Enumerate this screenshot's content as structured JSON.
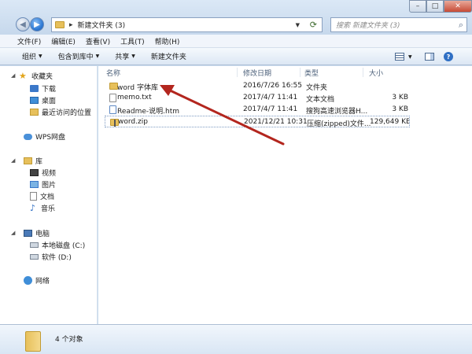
{
  "window": {
    "path": "新建文件夹 (3)",
    "search_placeholder": "搜索 新建文件夹 (3)"
  },
  "menu": [
    "文件(F)",
    "编辑(E)",
    "查看(V)",
    "工具(T)",
    "帮助(H)"
  ],
  "toolbar": [
    "组织",
    "包含到库中",
    "共享",
    "新建文件夹"
  ],
  "nav": {
    "favorites": "收藏夹",
    "downloads": "下载",
    "desktop": "桌面",
    "recent": "最近访问的位置",
    "wps": "WPS网盘",
    "libraries": "库",
    "videos": "视频",
    "pictures": "图片",
    "documents": "文档",
    "music": "音乐",
    "computer": "电脑",
    "local_disk": "本地磁盘 (C:)",
    "soft_disk": "软件 (D:)",
    "network": "网络"
  },
  "columns": {
    "name": "名称",
    "date": "修改日期",
    "type": "类型",
    "size": "大小"
  },
  "files": [
    {
      "name": "word  字体库",
      "date": "2016/7/26 16:55",
      "type": "文件夹",
      "size": "",
      "icon": "folder-icon"
    },
    {
      "name": "memo.txt",
      "date": "2017/4/7 11:41",
      "type": "文本文档",
      "size": "3 KB",
      "icon": "text-file-icon"
    },
    {
      "name": "Readme-说明.htm",
      "date": "2017/4/7 11:41",
      "type": "搜狗高速浏览器H...",
      "size": "3 KB",
      "icon": "html-file-icon"
    },
    {
      "name": "word.zip",
      "date": "2021/12/21 10:31",
      "type": "压缩(zipped)文件...",
      "size": "129,649 KB",
      "icon": "zip-file-icon"
    }
  ],
  "status": {
    "count": "4 个对象"
  },
  "colors": {
    "arrow": "#b3261e",
    "accent": "#3b78c9",
    "folder": "#e7c05b"
  }
}
